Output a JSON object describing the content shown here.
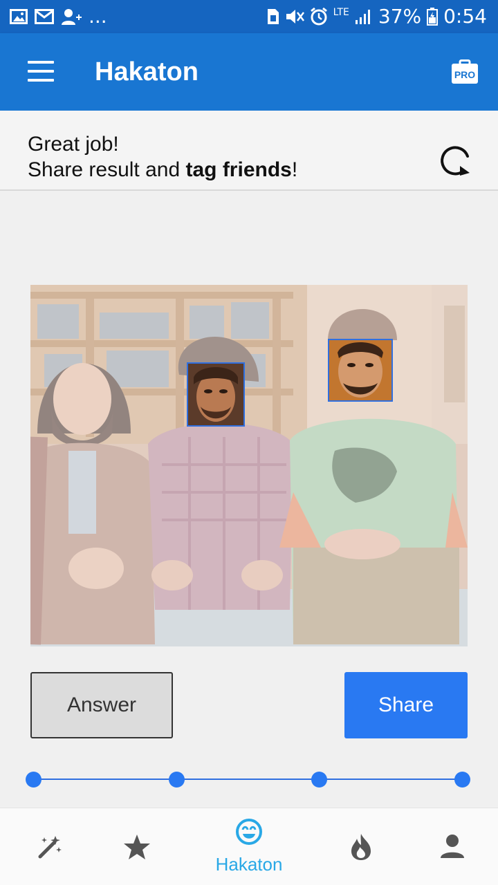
{
  "status_bar": {
    "left_icons": [
      "image-icon",
      "mail-icon",
      "add-contact-icon"
    ],
    "more": "...",
    "right_icons": [
      "sim-icon",
      "mute-icon",
      "alarm-icon"
    ],
    "network": "LTE",
    "battery": "37%",
    "time": "0:54"
  },
  "app_bar": {
    "title": "Hakaton",
    "menu_icon": "hamburger-menu-icon",
    "pro_badge": "PRO"
  },
  "message": {
    "line1": "Great job!",
    "line2_prefix": "Share result and ",
    "line2_bold": "tag friends",
    "line2_suffix": "!",
    "refresh_icon": "refresh-icon"
  },
  "photo": {
    "faces_tagged": 2
  },
  "actions": {
    "answer_label": "Answer",
    "share_label": "Share"
  },
  "progress": {
    "steps": 4,
    "accent": "#2979f2"
  },
  "bottom_nav": {
    "items": [
      {
        "icon": "magic-wand-icon",
        "label": ""
      },
      {
        "icon": "star-icon",
        "label": ""
      },
      {
        "icon": "smiley-icon",
        "label": "Hakaton",
        "active": true
      },
      {
        "icon": "flame-icon",
        "label": ""
      },
      {
        "icon": "person-icon",
        "label": ""
      }
    ]
  },
  "colors": {
    "status_bar": "#1565c0",
    "app_bar": "#1976d2",
    "active_nav": "#29a8e6",
    "share_button": "#2979f2"
  }
}
